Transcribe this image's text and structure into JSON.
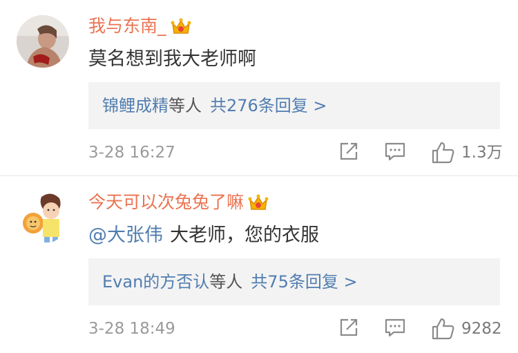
{
  "comments": [
    {
      "username": "我与东南_",
      "text": "莫名想到我大老师啊",
      "mention": "",
      "reply_names": "锦鲤成精",
      "reply_suffix": "等人",
      "reply_count": "共276条回复 >",
      "time": "3-28 16:27",
      "likes": "1.3万",
      "avatar": "avatar-photo",
      "badge": "crown-icon"
    },
    {
      "username": "今天可以次兔兔了嘛",
      "text": "大老师，您的衣服",
      "mention": "@大张伟",
      "reply_names": "Evan的方否认",
      "reply_suffix": "等人",
      "reply_count": "共75条回复 >",
      "time": "3-28 18:49",
      "likes": "9282",
      "avatar": "cartoon-lion-avatar",
      "badge": "crown-icon"
    }
  ],
  "colors": {
    "username": "#eb7350",
    "link": "#507daf",
    "reply_bg": "#f3f3f3",
    "meta": "#9a9a9a"
  }
}
